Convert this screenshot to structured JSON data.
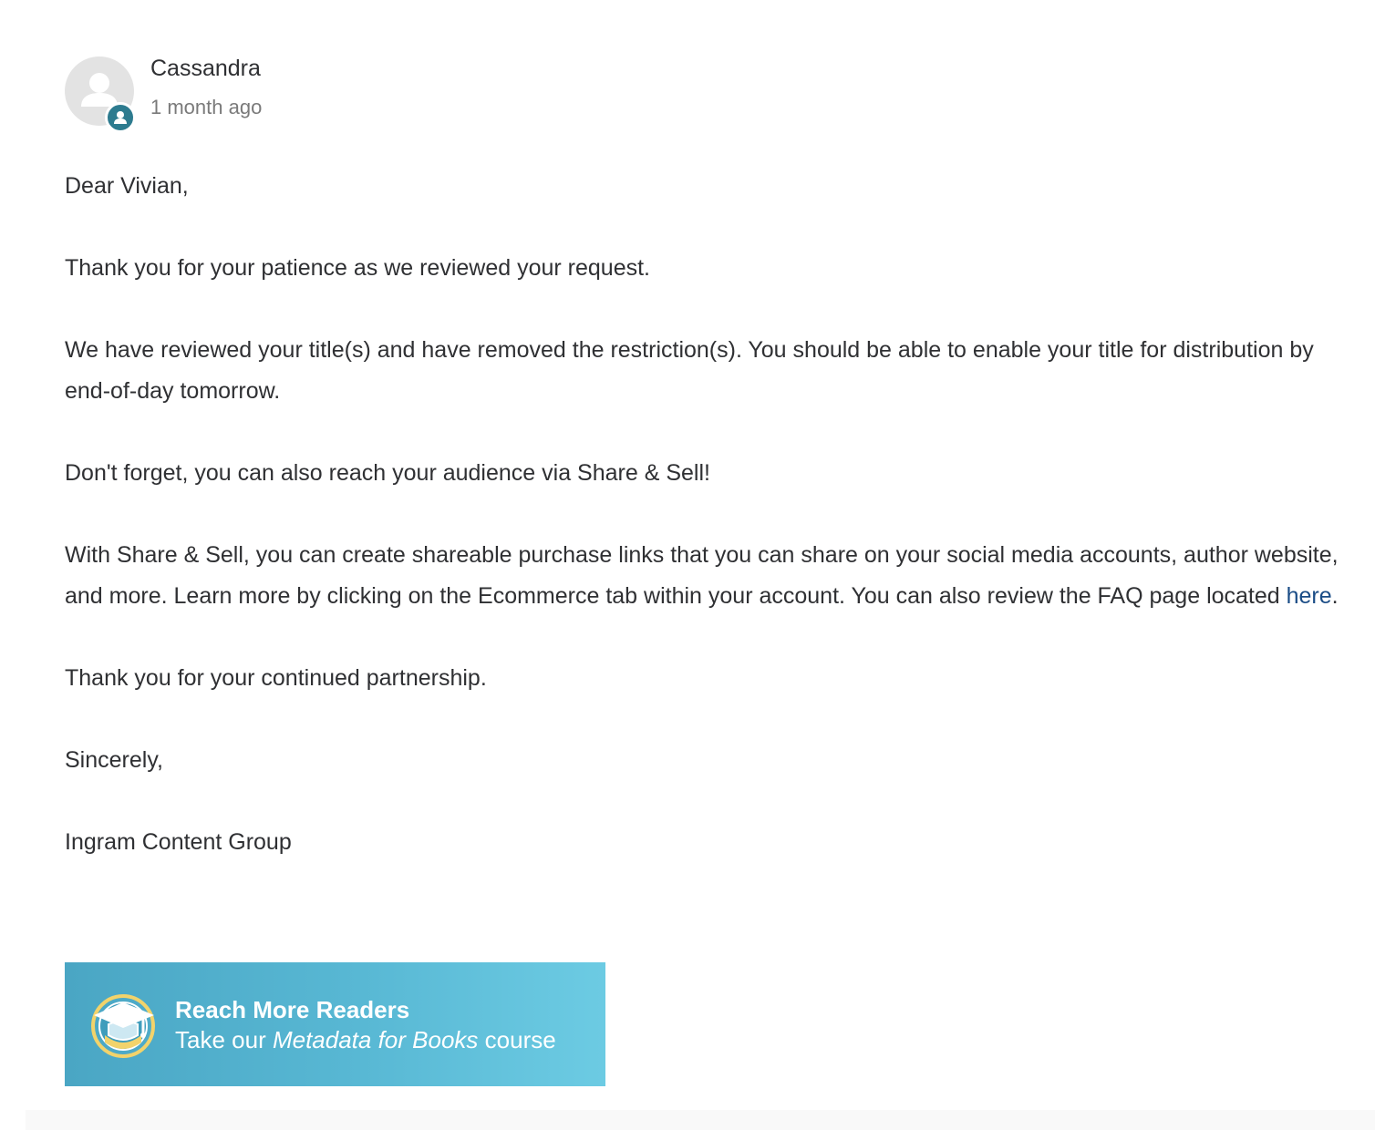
{
  "comment": {
    "author": "Cassandra",
    "timestamp": "1 month ago",
    "avatar_icon": "person-avatar-icon",
    "badge_icon": "user-badge-icon",
    "paragraphs": {
      "greeting": "Dear Vivian,",
      "p1": "Thank you for your patience as we reviewed your request.",
      "p2": "We have reviewed your title(s) and have removed the restriction(s). You should be able to enable your title for distribution by end-of-day tomorrow.",
      "p3": "Don't forget, you can also reach your audience via Share & Sell!",
      "p4_before_link": "With Share & Sell, you can create shareable purchase links that you can share on your social media accounts, author website, and more. Learn more by clicking on the Ecommerce tab within your account. You can also review the FAQ page located ",
      "p4_link": "here",
      "p4_after_link": ".",
      "p5": "Thank you for your continued partnership.",
      "closing": "Sincerely,",
      "signature": "Ingram Content Group"
    }
  },
  "banner": {
    "title": "Reach More Readers",
    "sub_before": "Take our ",
    "sub_em": "Metadata for Books",
    "sub_after": " course",
    "icon": "graduation-cap-icon",
    "color_start": "#4aa6c4",
    "color_end": "#6ccbe3"
  },
  "colors": {
    "text": "#2f3033",
    "muted": "#7a7a7a",
    "link": "#1a4c86",
    "badge": "#2d7b8f",
    "avatar_bg": "#e3e3e3"
  }
}
